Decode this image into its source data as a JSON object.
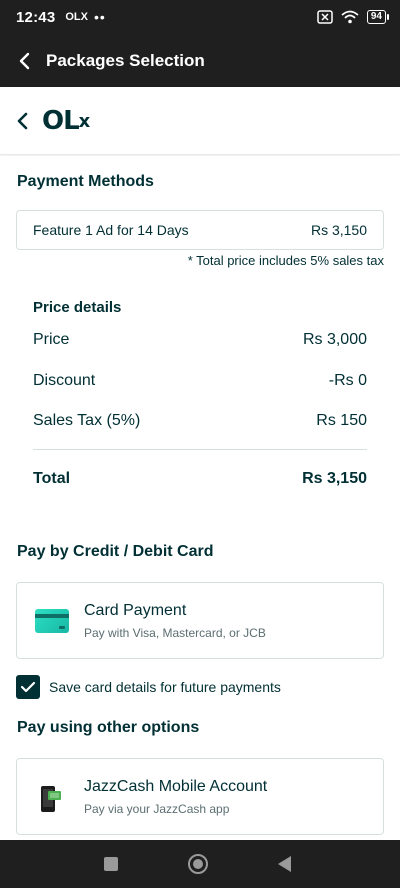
{
  "status_bar": {
    "time": "12:43",
    "app_indicator": "OLX",
    "dots": "••",
    "battery": "94"
  },
  "app_bar": {
    "title": "Packages Selection"
  },
  "brand": {
    "logo_text": "OL",
    "logo_x": "x"
  },
  "payment": {
    "title": "Payment Methods",
    "feature_label": "Feature 1 Ad for 14 Days",
    "feature_price": "Rs 3,150",
    "tax_note": "* Total price includes 5% sales tax"
  },
  "price_details": {
    "title": "Price details",
    "rows": [
      {
        "label": "Price",
        "value": "Rs 3,000"
      },
      {
        "label": "Discount",
        "value": "-Rs 0"
      },
      {
        "label": "Sales Tax (5%)",
        "value": "Rs 150"
      }
    ],
    "total_label": "Total",
    "total_value": "Rs 3,150"
  },
  "card_section": {
    "title": "Pay by Credit / Debit Card",
    "option_title": "Card Payment",
    "option_sub": "Pay with Visa, Mastercard, or JCB",
    "save_label": "Save card details for future payments",
    "save_checked": true
  },
  "other_section": {
    "title": "Pay using other options",
    "option_title": "JazzCash Mobile Account",
    "option_sub": "Pay via your JazzCash app"
  },
  "colors": {
    "primary": "#002f34",
    "dark_bar": "#1f1f1f",
    "card_accent": "#23cdb6",
    "border": "#d8dfe0"
  }
}
